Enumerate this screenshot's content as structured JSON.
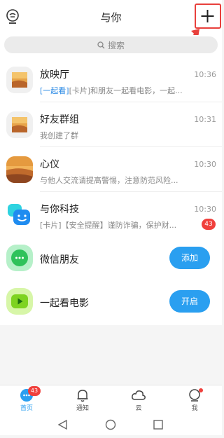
{
  "header": {
    "title": "与你"
  },
  "search": {
    "placeholder": "搜索"
  },
  "conversations": [
    {
      "name": "放映厅",
      "tag": "[一起看]",
      "preview": "[卡片]和朋友一起看电影，一起...",
      "time": "10:36"
    },
    {
      "name": "好友群组",
      "tag": "",
      "preview": "我创建了群",
      "time": "10:31"
    },
    {
      "name": "心仪",
      "tag": "",
      "preview": "与他人交流请提高警惕，注意防范风险...",
      "time": "10:30"
    },
    {
      "name": "与你科技",
      "tag": "",
      "preview": "[卡片]【安全提醒】谨防诈骗，保护财...",
      "time": "10:30",
      "badge": "43"
    }
  ],
  "recommendations": [
    {
      "name": "微信朋友",
      "button": "添加",
      "icon": "wechat-icon",
      "color": "#2fc25b"
    },
    {
      "name": "一起看电影",
      "button": "开启",
      "icon": "play-icon",
      "color": "#7ed321"
    }
  ],
  "tabs": [
    {
      "label": "首页",
      "icon": "chat-bubble-icon",
      "badge": "43",
      "active": true
    },
    {
      "label": "通知",
      "icon": "bell-icon"
    },
    {
      "label": "云",
      "icon": "cloud-icon"
    },
    {
      "label": "我",
      "icon": "profile-icon",
      "dot": true
    }
  ],
  "colors": {
    "accent": "#2a9ff0",
    "badge": "#f0403c",
    "annotation": "#e8403c"
  }
}
